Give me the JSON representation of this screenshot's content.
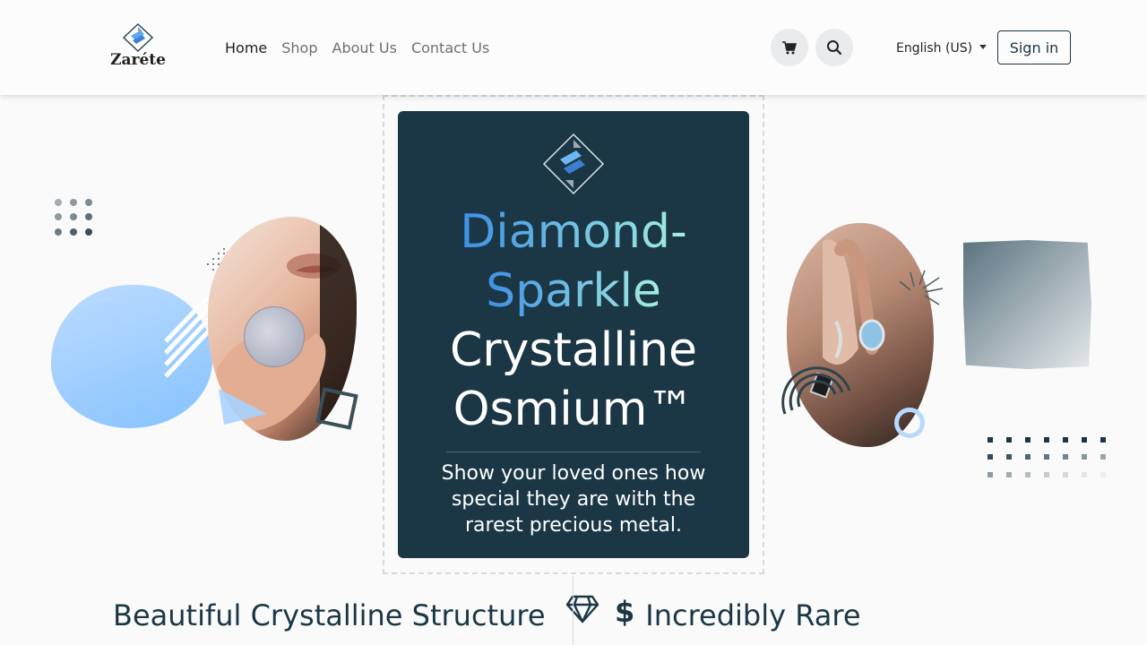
{
  "header": {
    "logo_text": "Zaréte",
    "nav": [
      {
        "label": "Home",
        "active": true
      },
      {
        "label": "Shop",
        "active": false
      },
      {
        "label": "About Us",
        "active": false
      },
      {
        "label": "Contact Us",
        "active": false
      }
    ],
    "cart_icon": "cart-icon",
    "search_icon": "search-icon",
    "language": "English (US)",
    "signin_label": "Sign in"
  },
  "hero": {
    "title_line1": "Diamond-",
    "title_line2": "Sparkle",
    "title_line3": "Crystalline",
    "title_line4": "Osmium™",
    "subtitle": "Show your loved ones how special they are with the rarest precious metal."
  },
  "features": [
    {
      "label": "Beautiful Crystalline Structure",
      "icon": "diamond-icon"
    },
    {
      "label": "Incredibly Rare",
      "icon": "dollar-icon"
    }
  ],
  "colors": {
    "dark_navy": "#1b3745",
    "gradient_start": "#3d8fe6",
    "gradient_end": "#a6f0e0",
    "light_blue": "#86c2ff"
  }
}
